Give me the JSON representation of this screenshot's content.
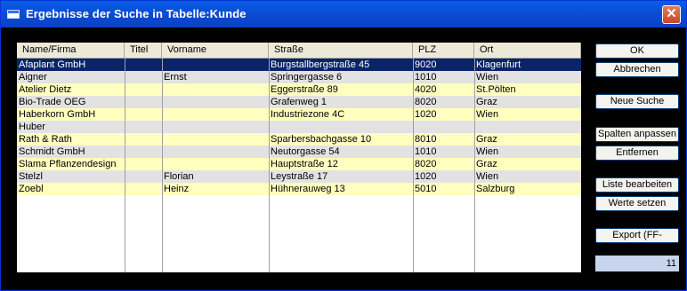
{
  "window": {
    "title": "Ergebnisse der Suche in Tabelle:Kunde",
    "close_label": "✕"
  },
  "table": {
    "columns": [
      "Name/Firma",
      "Titel",
      "Vorname",
      "Straße",
      "PLZ",
      "Ort"
    ],
    "rows": [
      [
        "Afaplant GmbH",
        "",
        "",
        "Burgstallbergstraße 45",
        "9020",
        "Klagenfurt"
      ],
      [
        "Aigner",
        "",
        "Ernst",
        "Springergasse 6",
        "1010",
        "Wien"
      ],
      [
        "Atelier Dietz",
        "",
        "",
        "Eggerstraße 89",
        "4020",
        "St.Pölten"
      ],
      [
        "Bio-Trade OEG",
        "",
        "",
        "Grafenweg 1",
        "8020",
        "Graz"
      ],
      [
        "Haberkorn GmbH",
        "",
        "",
        "Industriezone 4C",
        "1020",
        "Wien"
      ],
      [
        "Huber",
        "",
        "",
        "",
        "",
        ""
      ],
      [
        "Rath & Rath",
        "",
        "",
        "Sparbersbachgasse 10",
        "8010",
        "Graz"
      ],
      [
        "Schmidt GmbH",
        "",
        "",
        "Neutorgasse 54",
        "1010",
        "Wien"
      ],
      [
        "Slama Pflanzendesign",
        "",
        "",
        "Hauptstraße 12",
        "8020",
        "Graz"
      ],
      [
        "Stelzl",
        "",
        "Florian",
        "Leystraße 17",
        "1020",
        "Wien"
      ],
      [
        "Zoebl",
        "",
        "Heinz",
        "Hühnerauweg 13",
        "5010",
        "Salzburg"
      ]
    ],
    "selected_row": 0
  },
  "buttons": {
    "ok": "OK",
    "cancel": "Abbrechen",
    "new_search": "Neue Suche",
    "fit_columns": "Spalten anpassen",
    "remove": "Entfernen",
    "edit_list": "Liste bearbeiten",
    "set_values": "Werte setzen",
    "export": "Export (FF-Format)"
  },
  "result_count": "11",
  "colors": {
    "selected": "#0a246a",
    "row_yellow": "#ffffc0",
    "row_gray": "#e2e2e2",
    "titlebar": "#0a4ed8"
  }
}
